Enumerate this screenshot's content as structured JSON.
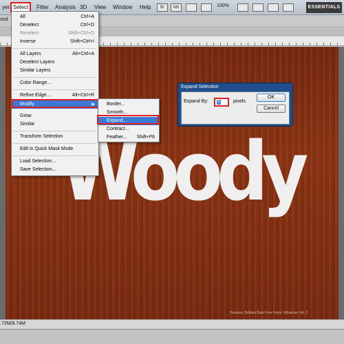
{
  "menubar": {
    "items": [
      {
        "label": "yer"
      },
      {
        "label": "Select"
      },
      {
        "label": "Filter"
      },
      {
        "label": "Analysis"
      },
      {
        "label": "3D"
      },
      {
        "label": "View"
      },
      {
        "label": "Window"
      },
      {
        "label": "Help"
      }
    ],
    "icons": [
      "Br",
      "Mb"
    ],
    "zoom": "100%",
    "workspace": "ESSENTIALS"
  },
  "options_bar": {
    "label": "ood"
  },
  "document": {
    "info": ".72M/8.74M"
  },
  "canvas": {
    "text": "Woody",
    "watermark": "Textures: Brilliant Bark    Free Fonts: Whatever Vol. 2"
  },
  "select_menu": {
    "items": [
      {
        "label": "All",
        "shortcut": "Ctrl+A"
      },
      {
        "label": "Deselect",
        "shortcut": "Ctrl+D"
      },
      {
        "label": "Reselect",
        "shortcut": "Shift+Ctrl+D",
        "disabled": true
      },
      {
        "label": "Inverse",
        "shortcut": "Shift+Ctrl+I"
      },
      {
        "label": "All Layers",
        "shortcut": "Alt+Ctrl+A"
      },
      {
        "label": "Deselect Layers",
        "shortcut": ""
      },
      {
        "label": "Similar Layers",
        "shortcut": ""
      },
      {
        "label": "Color Range...",
        "shortcut": ""
      },
      {
        "label": "Refine Edge...",
        "shortcut": "Alt+Ctrl+R"
      },
      {
        "label": "Modify",
        "shortcut": ""
      },
      {
        "label": "Grow",
        "shortcut": ""
      },
      {
        "label": "Similar",
        "shortcut": ""
      },
      {
        "label": "Transform Selection",
        "shortcut": ""
      },
      {
        "label": "Edit in Quick Mask Mode",
        "shortcut": ""
      },
      {
        "label": "Load Selection...",
        "shortcut": ""
      },
      {
        "label": "Save Selection...",
        "shortcut": ""
      }
    ]
  },
  "modify_submenu": {
    "items": [
      {
        "label": "Border...",
        "shortcut": ""
      },
      {
        "label": "Smooth...",
        "shortcut": ""
      },
      {
        "label": "Expand...",
        "shortcut": ""
      },
      {
        "label": "Contract...",
        "shortcut": ""
      },
      {
        "label": "Feather...",
        "shortcut": "Shift+F6"
      }
    ]
  },
  "dialog": {
    "title": "Expand Selection",
    "label": "Expand By:",
    "value": "5",
    "unit": "pixels",
    "ok": "OK",
    "cancel": "Cancel"
  },
  "colors": {
    "highlight": "#3a79d5",
    "annotation_red": "#e02020",
    "wood": "#8f3514",
    "dialog_frame": "#1f4e8c"
  }
}
